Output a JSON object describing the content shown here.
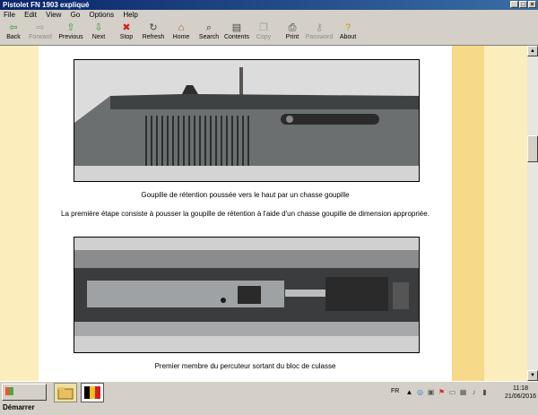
{
  "window": {
    "title": "Pistolet FN 1903 expliqué"
  },
  "menu": [
    "File",
    "Edit",
    "View",
    "Go",
    "Options",
    "Help"
  ],
  "toolbar": {
    "buttons": [
      {
        "label": "Back",
        "icon": "arrow-left-icon",
        "glyph": "⇦",
        "color": "#2f9b2f",
        "enabled": true
      },
      {
        "label": "Forward",
        "icon": "arrow-right-icon",
        "glyph": "⇨",
        "color": "#9a9a9a",
        "enabled": false
      },
      {
        "label": "Previous",
        "icon": "arrow-up-icon",
        "glyph": "⇧",
        "color": "#2f9b2f",
        "enabled": true
      },
      {
        "label": "Next",
        "icon": "arrow-down-icon",
        "glyph": "⇩",
        "color": "#2f9b2f",
        "enabled": true
      },
      {
        "label": "Stop",
        "icon": "stop-icon",
        "glyph": "✖",
        "color": "#d61f1f",
        "enabled": true
      },
      {
        "label": "Refresh",
        "icon": "refresh-icon",
        "glyph": "↻",
        "color": "#444444",
        "enabled": true
      },
      {
        "label": "Home",
        "icon": "home-icon",
        "glyph": "⌂",
        "color": "#a0522d",
        "enabled": true
      },
      {
        "label": "Search",
        "icon": "search-icon",
        "glyph": "⌕",
        "color": "#333333",
        "enabled": true
      },
      {
        "label": "Contents",
        "icon": "contents-icon",
        "glyph": "▤",
        "color": "#444444",
        "enabled": true
      },
      {
        "label": "Copy",
        "icon": "copy-icon",
        "glyph": "❐",
        "color": "#9a9a9a",
        "enabled": false
      },
      {
        "label": "Print",
        "icon": "print-icon",
        "glyph": "⎙",
        "color": "#333333",
        "enabled": true
      },
      {
        "label": "Password",
        "icon": "key-icon",
        "glyph": "⚷",
        "color": "#9a9a9a",
        "enabled": false
      },
      {
        "label": "About",
        "icon": "help-icon",
        "glyph": "?",
        "color": "#c8a000",
        "enabled": true
      }
    ]
  },
  "document": {
    "caption1": "Goupille de rétention poussée vers le haut par un chasse goupille",
    "paragraph": "La première étape consiste à pousser la goupille de rétention à l'aide d'un chasse goupille de dimension appropriée.",
    "caption2": "Premier membre du percuteur sortant du bloc de culasse"
  },
  "taskbar": {
    "start_label": "Démarrer",
    "language": "FR",
    "time": "11:18",
    "date": "21/06/2016"
  }
}
